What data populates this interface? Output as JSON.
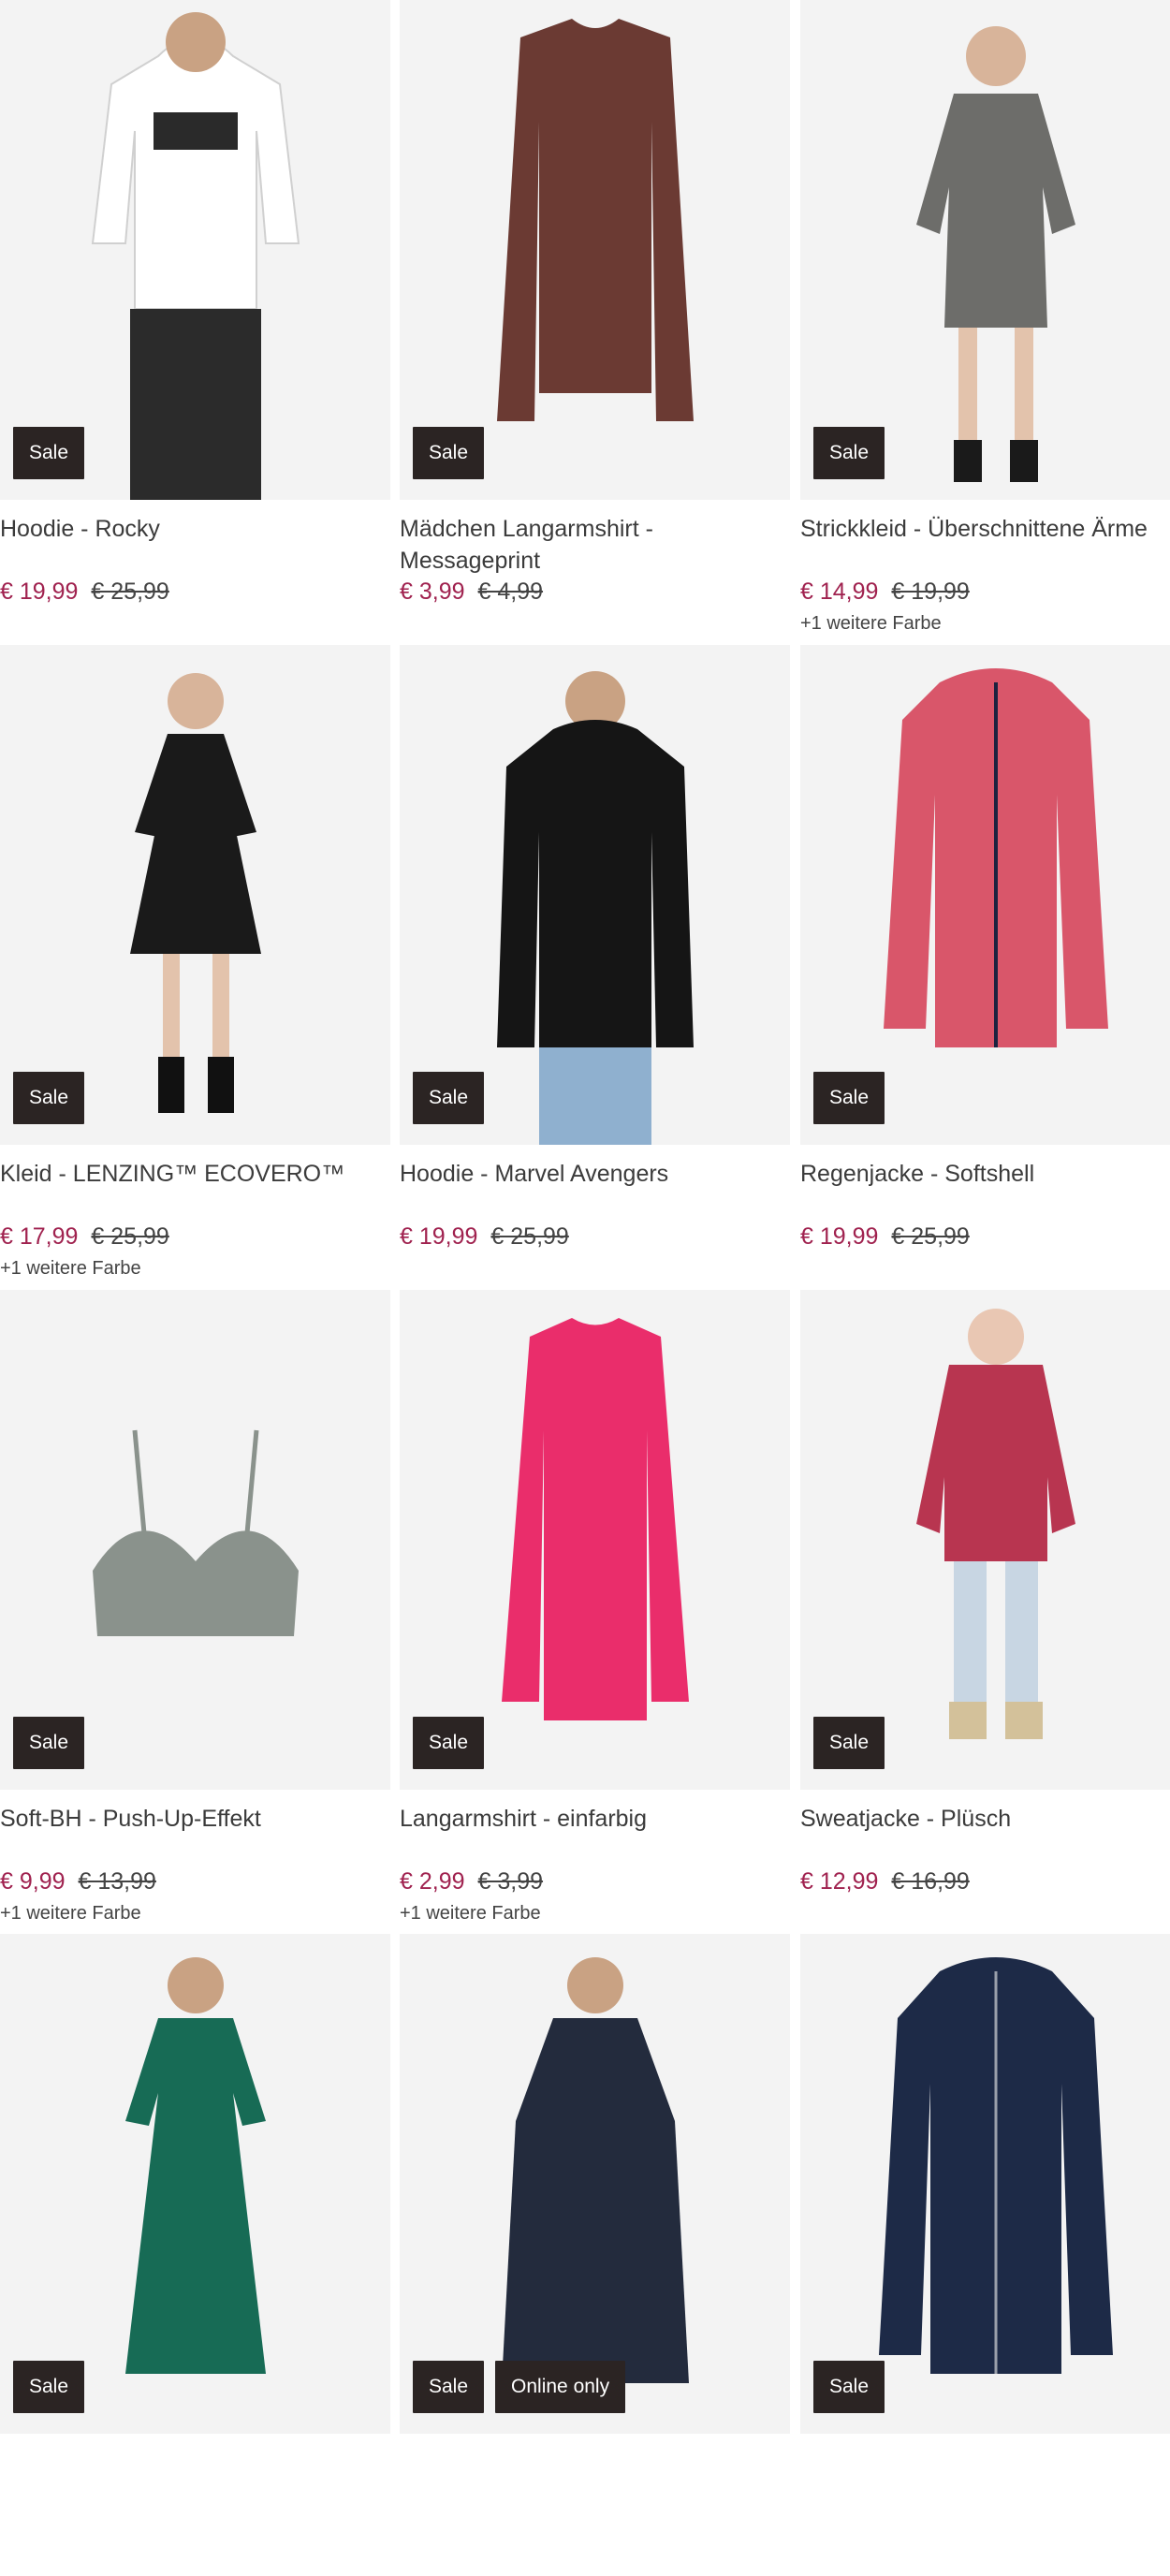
{
  "products": [
    {
      "title": "Hoodie - Rocky",
      "price": "€ 19,99",
      "old_price": "€ 25,99",
      "badges": [
        "Sale"
      ],
      "colors_note": "",
      "image_icon": "hoodie-white-icon",
      "image_color": "#ffffff"
    },
    {
      "title": "Mädchen Langarmshirt - Messageprint",
      "price": "€ 3,99",
      "old_price": "€ 4,99",
      "badges": [
        "Sale"
      ],
      "colors_note": "",
      "image_icon": "longsleeve-print-icon",
      "image_color": "#6b3a33"
    },
    {
      "title": "Strickkleid - Überschnittene Ärme",
      "price": "€ 14,99",
      "old_price": "€ 19,99",
      "badges": [
        "Sale"
      ],
      "colors_note": "+1 weitere Farbe",
      "image_icon": "knit-dress-icon",
      "image_color": "#6d6d6a"
    },
    {
      "title": "Kleid - LENZING™ ECOVERO™",
      "price": "€ 17,99",
      "old_price": "€ 25,99",
      "badges": [
        "Sale"
      ],
      "colors_note": "+1 weitere Farbe",
      "image_icon": "dress-black-icon",
      "image_color": "#1a1a1a"
    },
    {
      "title": "Hoodie - Marvel Avengers",
      "price": "€ 19,99",
      "old_price": "€ 25,99",
      "badges": [
        "Sale"
      ],
      "colors_note": "",
      "image_icon": "hoodie-black-icon",
      "image_color": "#151515"
    },
    {
      "title": "Regenjacke - Softshell",
      "price": "€ 19,99",
      "old_price": "€ 25,99",
      "badges": [
        "Sale"
      ],
      "colors_note": "",
      "image_icon": "jacket-hearts-icon",
      "image_color": "#d9566a"
    },
    {
      "title": "Soft-BH - Push-Up-Effekt",
      "price": "€ 9,99",
      "old_price": "€ 13,99",
      "badges": [
        "Sale"
      ],
      "colors_note": "+1 weitere Farbe",
      "image_icon": "bra-icon",
      "image_color": "#8a928c"
    },
    {
      "title": "Langarmshirt - einfarbig",
      "price": "€ 2,99",
      "old_price": "€ 3,99",
      "badges": [
        "Sale"
      ],
      "colors_note": "+1 weitere Farbe",
      "image_icon": "longsleeve-pink-icon",
      "image_color": "#ea2d6b"
    },
    {
      "title": "Sweatjacke - Plüsch",
      "price": "€ 12,99",
      "old_price": "€ 16,99",
      "badges": [
        "Sale"
      ],
      "colors_note": "",
      "image_icon": "plush-jacket-icon",
      "image_color": "#b83550"
    },
    {
      "title": "",
      "price": "",
      "old_price": "",
      "badges": [
        "Sale"
      ],
      "colors_note": "",
      "image_icon": "maxi-dress-green-icon",
      "image_color": "#176b55"
    },
    {
      "title": "",
      "price": "",
      "old_price": "",
      "badges": [
        "Sale",
        "Online only"
      ],
      "colors_note": "",
      "image_icon": "raincoat-navy-icon",
      "image_color": "#232b3d"
    },
    {
      "title": "",
      "price": "",
      "old_price": "",
      "badges": [
        "Sale"
      ],
      "colors_note": "",
      "image_icon": "zip-hoodie-navy-icon",
      "image_color": "#1d2a47"
    }
  ]
}
